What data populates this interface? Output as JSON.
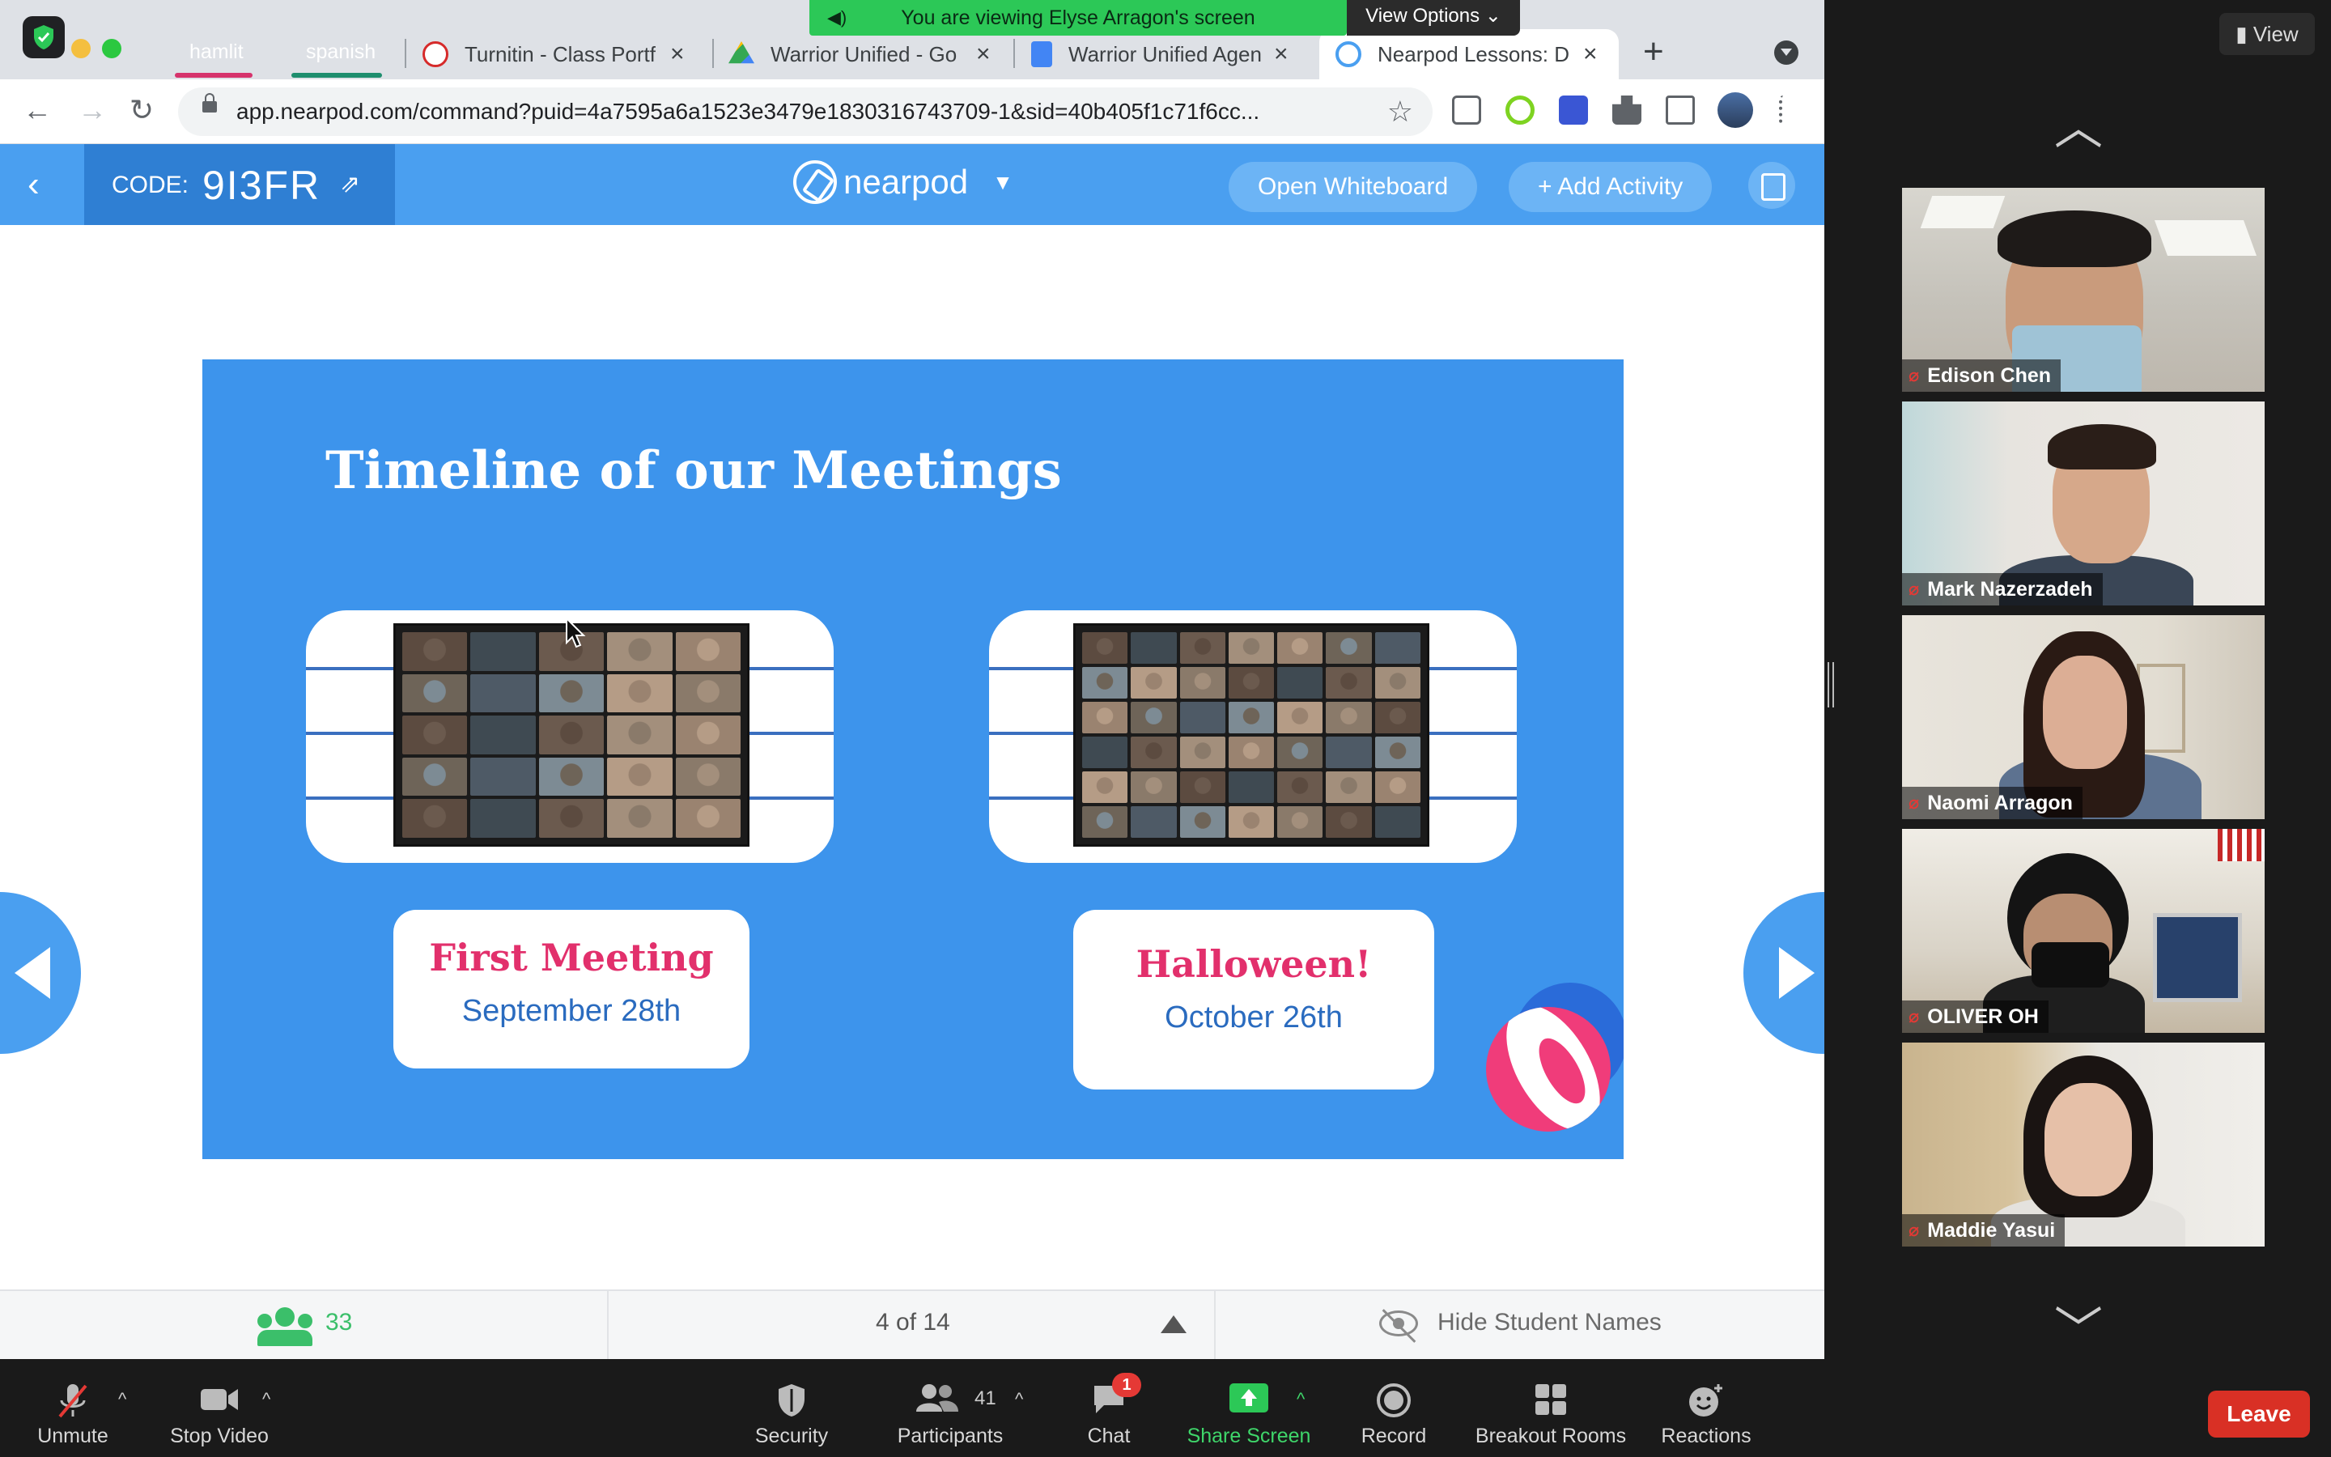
{
  "banner": {
    "viewing_text": "You are viewing Elyse Arragon's screen",
    "view_options_label": "View Options ⌄"
  },
  "browser": {
    "tab_groups": [
      {
        "label": "hamlit",
        "color": "#d6336c"
      },
      {
        "label": "spanish",
        "color": "#1e8e6e"
      }
    ],
    "tabs": [
      {
        "title": "Turnitin - Class Portf",
        "icon": "turnitin-icon"
      },
      {
        "title": "Warrior Unified - Go",
        "icon": "google-drive-icon"
      },
      {
        "title": "Warrior Unified Agen",
        "icon": "google-docs-icon"
      },
      {
        "title": "Nearpod Lessons: D",
        "icon": "nearpod-icon",
        "active": true
      }
    ],
    "url": "app.nearpod.com/command?puid=4a7595a6a1523e3479e1830316743709-1&sid=40b405f1c71f6cc..."
  },
  "nearpod": {
    "code_label": "CODE:",
    "code_value": "9I3FR",
    "logo_text": "nearpod",
    "open_whiteboard_label": "Open Whiteboard",
    "add_activity_label": "+ Add Activity",
    "slide": {
      "title": "Timeline of our Meetings",
      "events": [
        {
          "title": "First Meeting",
          "date": "September 28th"
        },
        {
          "title": "Halloween!",
          "date": "October 26th"
        }
      ]
    },
    "footer": {
      "student_count": "33",
      "pager": "4 of 14",
      "hide_names_label": "Hide Student Names"
    }
  },
  "gallery": {
    "view_label": "View",
    "participants": [
      {
        "name": "Edison Chen"
      },
      {
        "name": "Mark Nazerzadeh"
      },
      {
        "name": "Naomi Arragon"
      },
      {
        "name": "OLIVER OH"
      },
      {
        "name": "Maddie Yasui"
      }
    ]
  },
  "toolbar": {
    "unmute_label": "Unmute",
    "stop_video_label": "Stop Video",
    "security_label": "Security",
    "participants_label": "Participants",
    "participants_count": "41",
    "chat_label": "Chat",
    "chat_badge": "1",
    "share_screen_label": "Share Screen",
    "record_label": "Record",
    "breakout_label": "Breakout Rooms",
    "reactions_label": "Reactions",
    "leave_label": "Leave"
  },
  "colors": {
    "nearpod_blue": "#4a9ff0",
    "share_green": "#2cc857",
    "leave_red": "#d93025",
    "caption_pink": "#e2306c"
  }
}
